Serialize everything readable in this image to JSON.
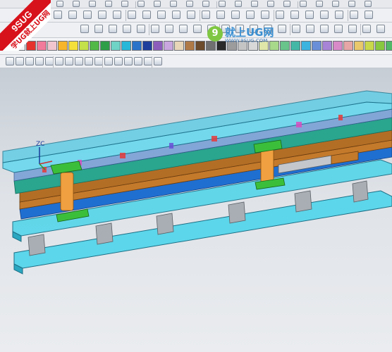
{
  "badge": {
    "line1": "9SUG",
    "line2": "学UG就上UG网"
  },
  "logo": {
    "mark": "9",
    "name": "就上UG网",
    "url": "WWW.9SUG.COM"
  },
  "palette": [
    "#f2f2f2",
    "#e6322d",
    "#f27b9b",
    "#f2c6cf",
    "#f7b52c",
    "#f4e03a",
    "#c4e04a",
    "#52b847",
    "#2f9e48",
    "#6fd3c6",
    "#27b7d8",
    "#2a73c9",
    "#1f3f9c",
    "#8d5dbb",
    "#c9a6de",
    "#e7d6b8",
    "#b07a46",
    "#6b4b2b",
    "#707070",
    "#2a2a2a",
    "#9c9c9c",
    "#c4c4c4",
    "#d8d8d8",
    "#dfe6a8",
    "#a8d88a",
    "#68c48a",
    "#44b7a6",
    "#3db3e0",
    "#6a8fd8",
    "#a884d6",
    "#d88ac8",
    "#e6a6a6",
    "#e8c86a",
    "#c8d84a",
    "#88c840",
    "#50b868"
  ],
  "icons": {
    "toolbar_row1": [
      "undo-icon",
      "redo-icon",
      "cut-icon",
      "copy-icon",
      "paste-icon",
      "delete-icon",
      "show-hide-icon",
      "layer-icon",
      "sketch-icon",
      "datum-icon",
      "view-icon",
      "render-icon",
      "snap-icon",
      "measure-icon",
      "analysis-icon",
      "curve-icon",
      "spline-icon",
      "trim-icon",
      "offset-icon",
      "extend-icon"
    ],
    "toolbar_row2": [
      "point-icon",
      "line-icon",
      "arc-icon",
      "circle-icon",
      "rectangle-icon",
      "polygon-icon",
      "fillet-icon",
      "chamfer-icon",
      "extrude-icon",
      "revolve-icon",
      "sweep-icon",
      "blend-icon",
      "mirror-icon",
      "pattern-icon",
      "hole-icon",
      "boss-icon",
      "pocket-icon",
      "shell-icon",
      "draft-icon",
      "unite-icon",
      "subtract-icon",
      "intersect-icon"
    ],
    "toolbar_row3": [
      "box-icon",
      "cylinder-icon",
      "cone-icon",
      "sphere-icon",
      "block-icon",
      "face-icon",
      "edge-icon",
      "body-icon",
      "move-icon",
      "rotate-icon",
      "scale-icon",
      "align-icon",
      "section-icon",
      "clip-icon",
      "wire-icon",
      "shade-icon",
      "fit-icon",
      "zoom-icon",
      "pan-icon",
      "orbit-icon",
      "refresh-icon",
      "hide-icon"
    ],
    "snap_row": [
      "select-all-icon",
      "end-point-icon",
      "mid-point-icon",
      "control-point-icon",
      "intersection-icon",
      "arc-center-icon",
      "quadrant-icon",
      "existing-point-icon",
      "point-on-curve-icon",
      "point-on-face-icon",
      "bounded-grid-icon",
      "filter-icon",
      "snap-point-icon",
      "curve-point-icon",
      "plus-icon",
      "tangent-icon"
    ]
  },
  "viewport": {
    "axis_label": "ZC"
  }
}
